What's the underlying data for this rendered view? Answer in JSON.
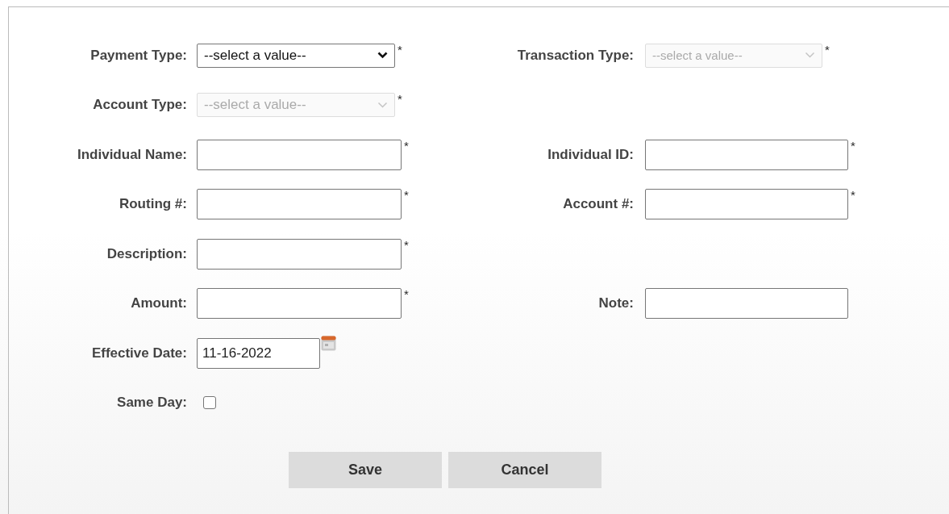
{
  "rows": [
    {
      "fields": [
        {
          "label": "Payment Type:",
          "kind": "select",
          "value": "--select a value--",
          "disabled": false,
          "required_mark": "*"
        },
        {
          "label": "Transaction Type:",
          "kind": "select",
          "value": "--select a value--",
          "disabled": true,
          "required_mark": "*"
        }
      ]
    },
    {
      "fields": [
        {
          "label": "Account Type:",
          "kind": "select",
          "value": "--select a value--",
          "disabled": true,
          "required_mark": "*"
        }
      ]
    },
    {
      "fields": [
        {
          "label": "Individual Name:",
          "kind": "text",
          "required_mark": "*"
        },
        {
          "label": "Individual ID:",
          "kind": "text",
          "required_mark": "*"
        }
      ]
    },
    {
      "fields": [
        {
          "label": "Routing #:",
          "kind": "text",
          "required_mark": "*"
        },
        {
          "label": "Account #:",
          "kind": "text",
          "required_mark": "*"
        }
      ]
    },
    {
      "fields": [
        {
          "label": "Description:",
          "kind": "text",
          "required_mark": "*"
        }
      ]
    },
    {
      "fields": [
        {
          "label": "Amount:",
          "kind": "text",
          "required_mark": "*"
        },
        {
          "label": "Note:",
          "kind": "text"
        }
      ]
    },
    {
      "fields": [
        {
          "label": "Effective Date:",
          "kind": "date",
          "value": "11-16-2022"
        }
      ]
    },
    {
      "fields": [
        {
          "label": "Same Day:",
          "kind": "checkbox",
          "checked": false
        }
      ]
    }
  ],
  "buttons": [
    "Save",
    "Cancel"
  ]
}
